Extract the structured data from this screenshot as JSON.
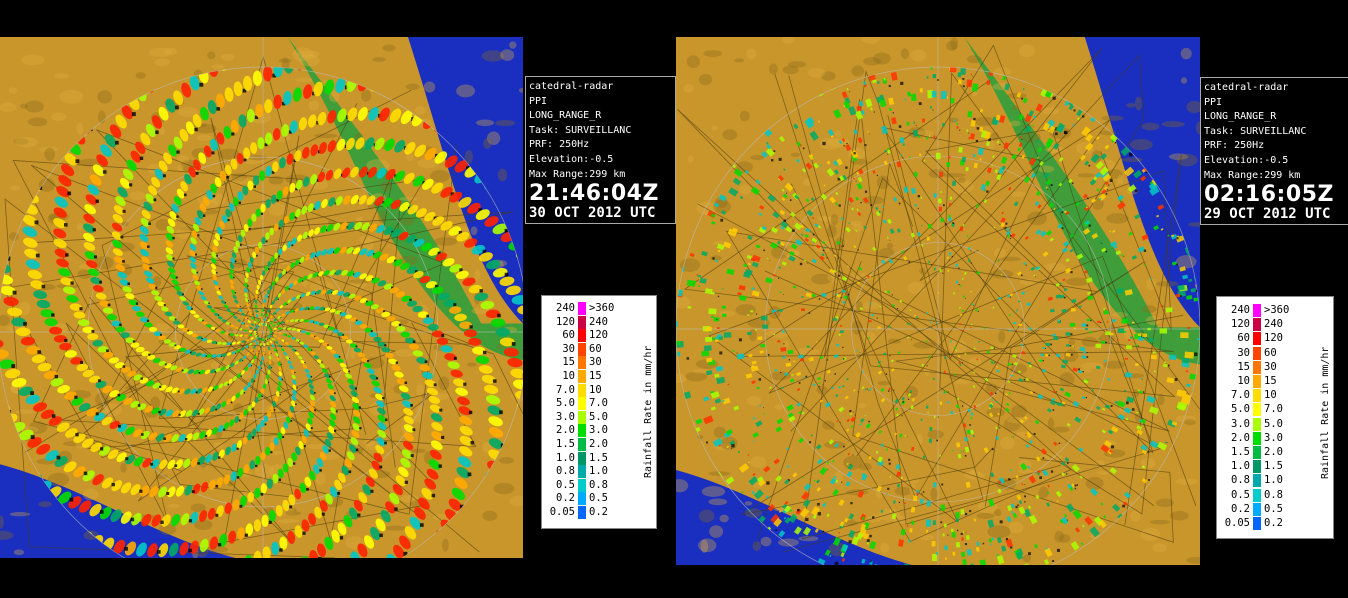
{
  "panels": [
    {
      "id": "left",
      "radar": "catedral-radar",
      "scan_mode": "PPI",
      "product": "LONG_RANGE_R",
      "task": "Task: SURVEILLANC",
      "prf": "PRF: 250Hz",
      "elevation": "Elevation:-0.5",
      "max_range": "Max Range:299 km",
      "time": "21:46:04Z",
      "date": "30 OCT 2012 UTC",
      "pattern": "spiral"
    },
    {
      "id": "right",
      "radar": "catedral-radar",
      "scan_mode": "PPI",
      "product": "LONG_RANGE_R",
      "task": "Task: SURVEILLANC",
      "prf": "PRF: 250Hz",
      "elevation": "Elevation:-0.5",
      "max_range": "Max Range:299 km",
      "time": "02:16:05Z",
      "date": "29 OCT 2012 UTC",
      "pattern": "speckle"
    }
  ],
  "legend": {
    "unit_label": "Rainfall Rate in mm/hr",
    "rows": [
      {
        "lo": "240",
        "hi": ">360",
        "color": "#ff00ff"
      },
      {
        "lo": "120",
        "hi": "240",
        "color": "#cc0044"
      },
      {
        "lo": "60",
        "hi": "120",
        "color": "#ff0000"
      },
      {
        "lo": "30",
        "hi": "60",
        "color": "#ff4400"
      },
      {
        "lo": "15",
        "hi": "30",
        "color": "#ff7700"
      },
      {
        "lo": "10",
        "hi": "15",
        "color": "#ffaa00"
      },
      {
        "lo": "7.0",
        "hi": "10",
        "color": "#ffdd00"
      },
      {
        "lo": "5.0",
        "hi": "7.0",
        "color": "#ffff00"
      },
      {
        "lo": "3.0",
        "hi": "5.0",
        "color": "#aaff00"
      },
      {
        "lo": "2.0",
        "hi": "3.0",
        "color": "#00dd00"
      },
      {
        "lo": "1.5",
        "hi": "2.0",
        "color": "#00bb44"
      },
      {
        "lo": "1.0",
        "hi": "1.5",
        "color": "#009966"
      },
      {
        "lo": "0.8",
        "hi": "1.0",
        "color": "#00aaaa"
      },
      {
        "lo": "0.5",
        "hi": "0.8",
        "color": "#00cccc"
      },
      {
        "lo": "0.2",
        "hi": "0.5",
        "color": "#00aaff"
      },
      {
        "lo": "0.05",
        "hi": "0.2",
        "color": "#0066ff"
      }
    ]
  },
  "colors": {
    "terrain": "#c8962a",
    "terrain_dark": "#8a6a1a",
    "lowland": "#3f9e3a",
    "ocean": "#1a2fbf",
    "range_ring": "#bdbdbd"
  }
}
